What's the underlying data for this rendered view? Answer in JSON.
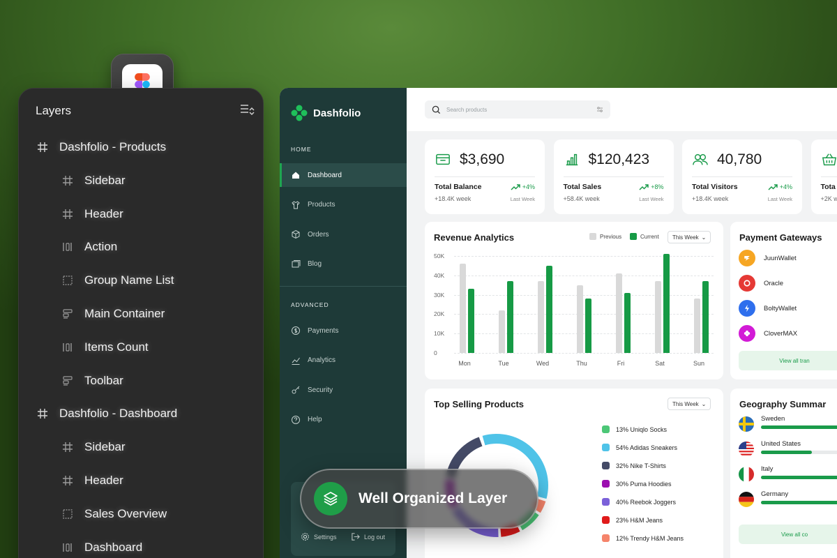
{
  "layers_panel": {
    "title": "Layers",
    "items": [
      {
        "label": "Dashfolio - Products",
        "kind": "frame",
        "icon": "frame-icon"
      },
      {
        "label": "Sidebar",
        "kind": "child",
        "icon": "frame-icon"
      },
      {
        "label": "Header",
        "kind": "child",
        "icon": "frame-icon"
      },
      {
        "label": "Action",
        "kind": "child",
        "icon": "auto-layout-h-icon"
      },
      {
        "label": "Group Name List",
        "kind": "child",
        "icon": "dashed-frame-icon"
      },
      {
        "label": "Main Container",
        "kind": "child",
        "icon": "auto-layout-v-icon"
      },
      {
        "label": "Items Count",
        "kind": "child",
        "icon": "auto-layout-h-icon"
      },
      {
        "label": "Toolbar",
        "kind": "child",
        "icon": "auto-layout-v-icon"
      },
      {
        "label": "Dashfolio - Dashboard",
        "kind": "frame",
        "icon": "frame-icon"
      },
      {
        "label": "Sidebar",
        "kind": "child",
        "icon": "frame-icon"
      },
      {
        "label": "Header",
        "kind": "child",
        "icon": "frame-icon"
      },
      {
        "label": "Sales Overview",
        "kind": "child",
        "icon": "dashed-frame-icon"
      },
      {
        "label": "Dashboard",
        "kind": "child",
        "icon": "auto-layout-h-icon"
      }
    ]
  },
  "app": {
    "brand": "Dashfolio",
    "sections": {
      "home": "HOME",
      "advanced": "ADVANCED"
    },
    "nav_home": [
      {
        "label": "Dashboard",
        "icon": "home-icon",
        "active": true
      },
      {
        "label": "Products",
        "icon": "shirt-icon",
        "active": false
      },
      {
        "label": "Orders",
        "icon": "box-icon",
        "active": false
      },
      {
        "label": "Blog",
        "icon": "blog-icon",
        "active": false
      }
    ],
    "nav_advanced": [
      {
        "label": "Payments",
        "icon": "dollar-icon"
      },
      {
        "label": "Analytics",
        "icon": "chart-line-icon"
      },
      {
        "label": "Security",
        "icon": "key-icon"
      },
      {
        "label": "Help",
        "icon": "help-icon"
      }
    ],
    "bottom": {
      "settings": "Settings",
      "logout": "Log out"
    },
    "search_placeholder": "Search products",
    "stats": [
      {
        "value": "$3,690",
        "label": "Total Balance",
        "sub": "+18.4K week",
        "pct": "+4%",
        "lw": "Last Week",
        "icon": "wallet-icon"
      },
      {
        "value": "$120,423",
        "label": "Total Sales",
        "sub": "+58.4K week",
        "pct": "+8%",
        "lw": "Last Week",
        "icon": "bar-chart-icon"
      },
      {
        "value": "40,780",
        "label": "Total Visitors",
        "sub": "+18.4K week",
        "pct": "+4%",
        "lw": "Last Week",
        "icon": "users-icon"
      },
      {
        "value": "",
        "label": "Tota",
        "sub": "+2K w",
        "pct": "",
        "lw": "",
        "icon": "basket-icon"
      }
    ],
    "revenue": {
      "title": "Revenue Analytics",
      "legend_prev": "Previous",
      "legend_curr": "Current",
      "dropdown": "This Week"
    },
    "payment_gateways": {
      "title": "Payment Gateways",
      "items": [
        {
          "name": "JuunWallet",
          "color": "#f6a623"
        },
        {
          "name": "Oracle",
          "color": "#e53935"
        },
        {
          "name": "BoltyWallet",
          "color": "#2f6fed"
        },
        {
          "name": "CloverMAX",
          "color": "#d21bd6"
        }
      ],
      "view_all": "View all tran"
    },
    "top_selling": {
      "title": "Top Selling Products",
      "dropdown": "This Week",
      "legend": [
        {
          "label": "13% Uniqlo Socks",
          "color": "#4cc777"
        },
        {
          "label": "54% Adidas Sneakers",
          "color": "#4fc3e8"
        },
        {
          "label": "32% Nike T-Shirts",
          "color": "#444a66"
        },
        {
          "label": "30% Puma Hoodies",
          "color": "#9c0fb0"
        },
        {
          "label": "40% Reebok Joggers",
          "color": "#7b61d9"
        },
        {
          "label": "23% H&M Jeans",
          "color": "#e01b1b"
        },
        {
          "label": "12% Trendy H&M Jeans",
          "color": "#f5846b"
        }
      ]
    },
    "geography": {
      "title": "Geography Summar",
      "items": [
        {
          "name": "Sweden",
          "fill": 0.85
        },
        {
          "name": "United States",
          "fill": 0.56
        },
        {
          "name": "Italy",
          "fill": 0.92
        },
        {
          "name": "Germany",
          "fill": 0.9
        }
      ],
      "view_all": "View all co"
    }
  },
  "badge": {
    "text": "Well Organized Layer"
  },
  "chart_data": {
    "type": "bar",
    "categories": [
      "Mon",
      "Tue",
      "Wed",
      "Thu",
      "Fri",
      "Sat",
      "Sun"
    ],
    "series": [
      {
        "name": "Previous",
        "values": [
          46000,
          22000,
          37000,
          35000,
          41000,
          37000,
          28000
        ],
        "color": "#d9d9d9"
      },
      {
        "name": "Current",
        "values": [
          33000,
          37000,
          45000,
          28000,
          31000,
          51000,
          37000
        ],
        "color": "#169a45"
      }
    ],
    "ylim": [
      0,
      50000
    ],
    "yticks": [
      "0",
      "10K",
      "20K",
      "30K",
      "40K",
      "50K"
    ]
  }
}
